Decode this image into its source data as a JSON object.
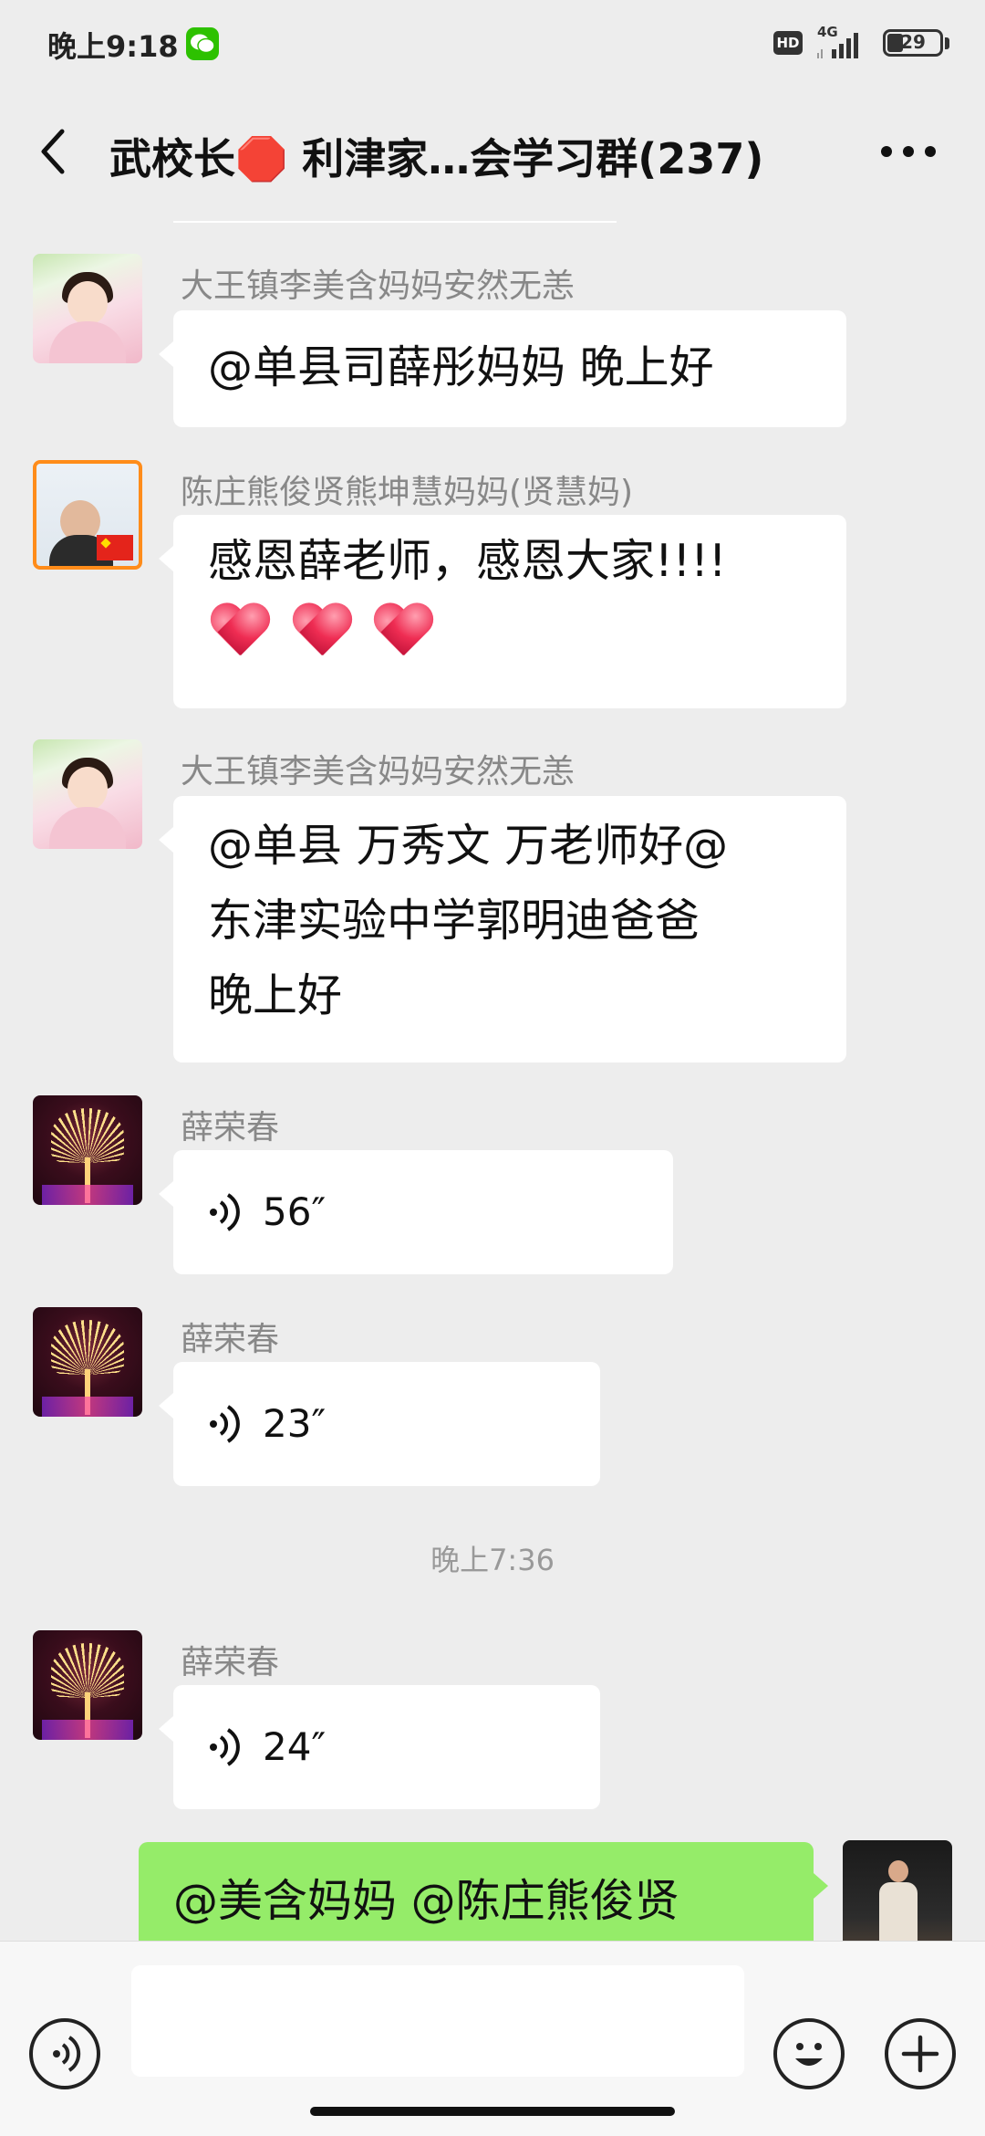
{
  "status_bar": {
    "time": "晚上9:18",
    "hd": "HD",
    "network": "4G",
    "battery": "29",
    "battery_level": 0.29
  },
  "header": {
    "title": "武校长🛑 利津家…会学习群(237)"
  },
  "messages": [
    {
      "sender": "大王镇李美含妈妈安然无恙",
      "text": "@单县司薛彤妈妈  晚上好",
      "avatar": "girl-avatar"
    },
    {
      "sender": "陈庄熊俊贤熊坤慧妈妈(贤慧妈)",
      "text": "感恩薛老师，感恩大家!!!!",
      "hearts": 3,
      "avatar": "kid-flag-avatar"
    },
    {
      "sender": "大王镇李美含妈妈安然无恙",
      "lines": [
        "@单县  万秀文  万老师好@",
        "东津实验中学郭明迪爸爸",
        "晚上好"
      ],
      "avatar": "girl-avatar"
    },
    {
      "sender": "薛荣春",
      "voice_duration": "56″",
      "avatar": "fireworks-avatar"
    },
    {
      "sender": "薛荣春",
      "voice_duration": "23″",
      "avatar": "fireworks-avatar"
    },
    {
      "sender": "薛荣春",
      "voice_duration": "24″",
      "avatar": "fireworks-avatar"
    }
  ],
  "timestamp": "晚上7:36",
  "my_message": {
    "text": "@美含妈妈  @陈庄熊俊贤"
  },
  "input": {
    "value": ""
  },
  "colors": {
    "background": "#ededed",
    "my_bubble": "#95ec69",
    "other_bubble": "#ffffff"
  }
}
